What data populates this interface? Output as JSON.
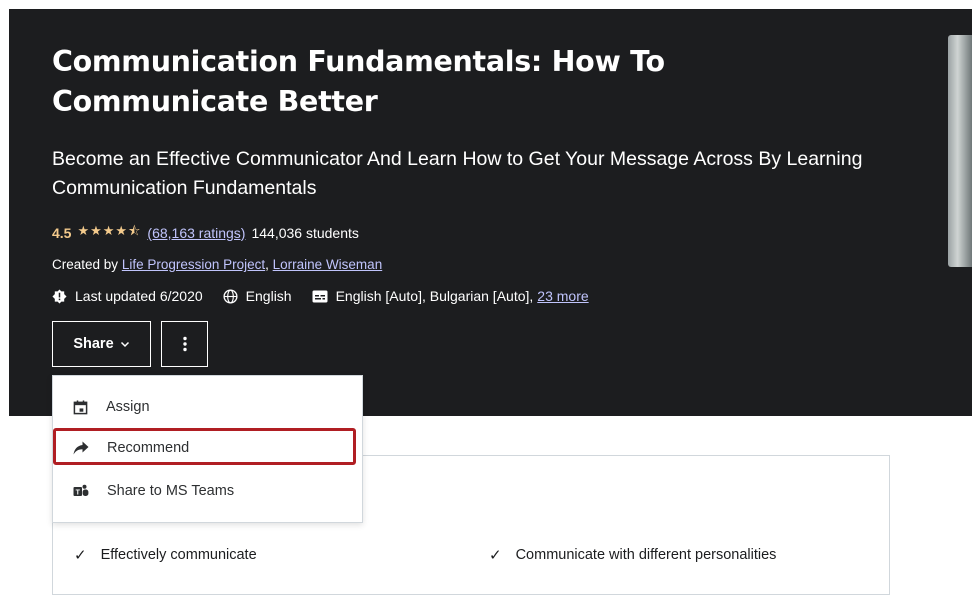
{
  "course": {
    "title": "Communication Fundamentals: How To Communicate Better",
    "subtitle": "Become an Effective Communicator And Learn How to Get Your Message Across By Learning Communication Fundamentals",
    "rating": "4.5",
    "stars_text": "★★★★⯪",
    "ratings_link": "(68,163 ratings)",
    "students": "144,036 students",
    "created_by_label": "Created by",
    "instructors": [
      "Life Progression Project",
      "Lorraine Wiseman"
    ],
    "last_updated": "Last updated 6/2020",
    "language": "English",
    "captions": "English [Auto], Bulgarian [Auto],",
    "captions_more": "23 more"
  },
  "actions": {
    "share_label": "Share",
    "chevron": "⌄"
  },
  "share_menu": {
    "items": [
      {
        "label": "Assign",
        "icon": "calendar-icon"
      },
      {
        "label": "Recommend",
        "icon": "share-arrow-icon"
      },
      {
        "label": "Share to MS Teams",
        "icon": "ms-teams-icon"
      }
    ]
  },
  "learn": {
    "items": [
      "Effectively communicate",
      "Communicate with different personalities"
    ]
  },
  "colors": {
    "hero_bg": "#1c1d1f",
    "rating": "#f3ca8c",
    "link": "#c0c4fc",
    "highlight": "#b01e23"
  }
}
